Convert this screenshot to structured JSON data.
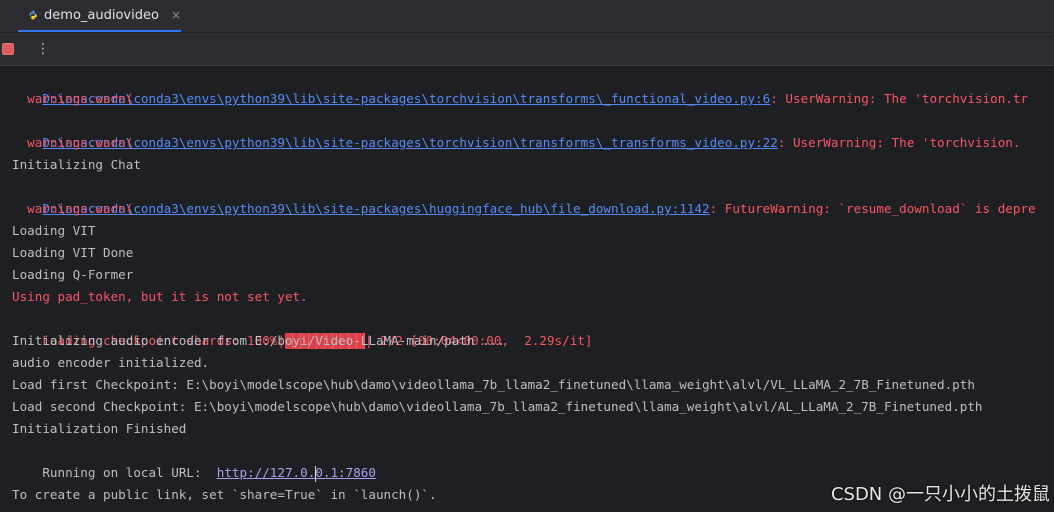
{
  "tab": {
    "label": "demo_audiovideo",
    "close": "×"
  },
  "toolbar": {
    "menu": "⋮"
  },
  "console": {
    "l1_path": "D:\\anaconda\\conda3\\envs\\python39\\lib\\site-packages\\torchvision\\transforms\\_functional_video.py:6",
    "l1_msg": ": UserWarning: The 'torchvision.tr",
    "l2": "  warnings.warn(",
    "l3_path": "D:\\anaconda\\conda3\\envs\\python39\\lib\\site-packages\\torchvision\\transforms\\_transforms_video.py:22",
    "l3_msg": ": UserWarning: The 'torchvision.",
    "l4": "  warnings.warn(",
    "l5": "Initializing Chat",
    "l6_path": "D:\\anaconda\\conda3\\envs\\python39\\lib\\site-packages\\huggingface_hub\\file_download.py:1142",
    "l6_msg": ": FutureWarning: `resume_download` is depre",
    "l7": "  warnings.warn(",
    "l8": "Loading VIT",
    "l9": "Loading VIT Done",
    "l10": "Loading Q-Former",
    "l11": "Using pad_token, but it is not set yet.",
    "l12_prefix": "Loading checkpoint shards: 100%|",
    "l12_suffix": "| 2/2 [00:04<00:00,  2.29s/it]",
    "l12_progress": 1.0,
    "l13": "Initializing audio encoder from E:/boyi/Video-LLaMA-main/path ...",
    "l14": "audio encoder initialized.",
    "l15": "Load first Checkpoint: E:\\boyi\\modelscope\\hub\\damo\\videollama_7b_llama2_finetuned\\llama_weight\\alvl/VL_LLaMA_2_7B_Finetuned.pth",
    "l16": "Load second Checkpoint: E:\\boyi\\modelscope\\hub\\damo\\videollama_7b_llama2_finetuned\\llama_weight\\alvl/AL_LLaMA_2_7B_Finetuned.pth",
    "l17": "Initialization Finished",
    "l18_prefix": "Running on local URL:  ",
    "l18_url_a": "http://127.0.",
    "l18_url_b": "0.1:7860",
    "l20": "To create a public link, set `share=True` in `launch()`."
  },
  "watermark": "CSDN @一只小小的土拨鼠"
}
